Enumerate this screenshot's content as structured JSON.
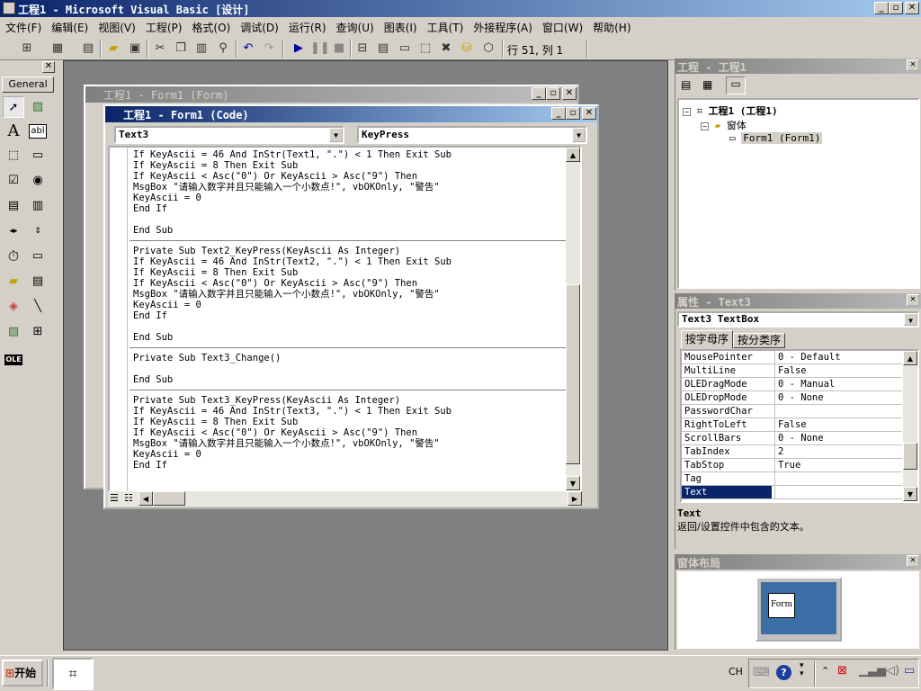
{
  "window": {
    "title": "工程1 - Microsoft Visual Basic [设计]",
    "min_glyph": "_",
    "restore_glyph": "▫",
    "close_glyph": "✕"
  },
  "menu": [
    "文件(F)",
    "编辑(E)",
    "视图(V)",
    "工程(P)",
    "格式(O)",
    "调试(D)",
    "运行(R)",
    "查询(U)",
    "图表(I)",
    "工具(T)",
    "外接程序(A)",
    "窗口(W)",
    "帮助(H)"
  ],
  "toolbar": {
    "position": "行 51, 列 1",
    "icons": [
      "add-project-icon",
      "add-form-icon",
      "menu-editor-icon",
      "open-icon",
      "save-icon",
      "cut-icon",
      "copy-icon",
      "paste-icon",
      "find-icon",
      "undo-icon",
      "redo-icon",
      "start-icon",
      "break-icon",
      "end-icon",
      "project-explorer-icon",
      "properties-icon",
      "form-layout-icon",
      "object-browser-icon",
      "toolbox-icon",
      "data-view-icon",
      "component-manager-icon"
    ]
  },
  "toolbox": {
    "tab_label": "General",
    "ole_label": "OLE",
    "tools": [
      "pointer-icon",
      "picturebox-icon",
      "label-icon",
      "textbox-icon",
      "frame-icon",
      "commandbutton-icon",
      "checkbox-icon",
      "optionbutton-icon",
      "combobox-icon",
      "listbox-icon",
      "hscrollbar-icon",
      "vscrollbar-icon",
      "timer-icon",
      "drivelistbox-icon",
      "dirlistbox-icon",
      "filelistbox-icon",
      "shape-icon",
      "line-icon",
      "image-icon",
      "data-icon",
      "ole-icon"
    ]
  },
  "form_window": {
    "title": "工程1 - Form1 (Form)"
  },
  "code_window": {
    "title": "工程1 - Form1 (Code)",
    "object_combo": "Text3",
    "procedure_combo": "KeyPress",
    "blocks": [
      [
        "If KeyAscii = 46 And InStr(Text1, \".\") < 1 Then Exit Sub",
        "If KeyAscii = 8 Then Exit Sub",
        "If KeyAscii < Asc(\"0\") Or KeyAscii > Asc(\"9\") Then",
        "MsgBox \"请输入数字并且只能输入一个小数点!\", vbOKOnly, \"警告\"",
        "KeyAscii = 0",
        "End If",
        "",
        "End Sub"
      ],
      [
        "Private Sub Text2_KeyPress(KeyAscii As Integer)",
        "If KeyAscii = 46 And InStr(Text2, \".\") < 1 Then Exit Sub",
        "If KeyAscii = 8 Then Exit Sub",
        "If KeyAscii < Asc(\"0\") Or KeyAscii > Asc(\"9\") Then",
        "MsgBox \"请输入数字并且只能输入一个小数点!\", vbOKOnly, \"警告\"",
        "KeyAscii = 0",
        "End If",
        "",
        "End Sub"
      ],
      [
        "Private Sub Text3_Change()",
        "",
        "End Sub"
      ],
      [
        "Private Sub Text3_KeyPress(KeyAscii As Integer)",
        "If KeyAscii = 46 And InStr(Text3, \".\") < 1 Then Exit Sub",
        "If KeyAscii = 8 Then Exit Sub",
        "If KeyAscii < Asc(\"0\") Or KeyAscii > Asc(\"9\") Then",
        "MsgBox \"请输入数字并且只能输入一个小数点!\", vbOKOnly, \"警告\"",
        "KeyAscii = 0",
        "End If"
      ]
    ]
  },
  "project_explorer": {
    "title": "工程 - 工程1",
    "root": "工程1 (工程1)",
    "folder": "窗体",
    "item": "Form1 (Form1)"
  },
  "properties": {
    "title": "属性 - Text3",
    "object": "Text3 TextBox",
    "tabs": [
      "按字母序",
      "按分类序"
    ],
    "rows": [
      {
        "name": "MousePointer",
        "value": "0 - Default"
      },
      {
        "name": "MultiLine",
        "value": "False"
      },
      {
        "name": "OLEDragMode",
        "value": "0 - Manual"
      },
      {
        "name": "OLEDropMode",
        "value": "0 - None"
      },
      {
        "name": "PasswordChar",
        "value": ""
      },
      {
        "name": "RightToLeft",
        "value": "False"
      },
      {
        "name": "ScrollBars",
        "value": "0 - None"
      },
      {
        "name": "TabIndex",
        "value": "2"
      },
      {
        "name": "TabStop",
        "value": "True"
      },
      {
        "name": "Tag",
        "value": ""
      },
      {
        "name": "Text",
        "value": ""
      }
    ],
    "selected": "Text",
    "desc_title": "Text",
    "desc_text": "返回/设置控件中包含的文本。"
  },
  "form_layout": {
    "title": "窗体布局",
    "form_label": "Form"
  },
  "taskbar": {
    "start_label": "开始",
    "lang": "CH",
    "tray_icons": [
      "keyboard-icon",
      "help-icon",
      "expand-icon",
      "network-warning-icon",
      "signal-icon",
      "volume-icon",
      "monitor-icon"
    ]
  }
}
